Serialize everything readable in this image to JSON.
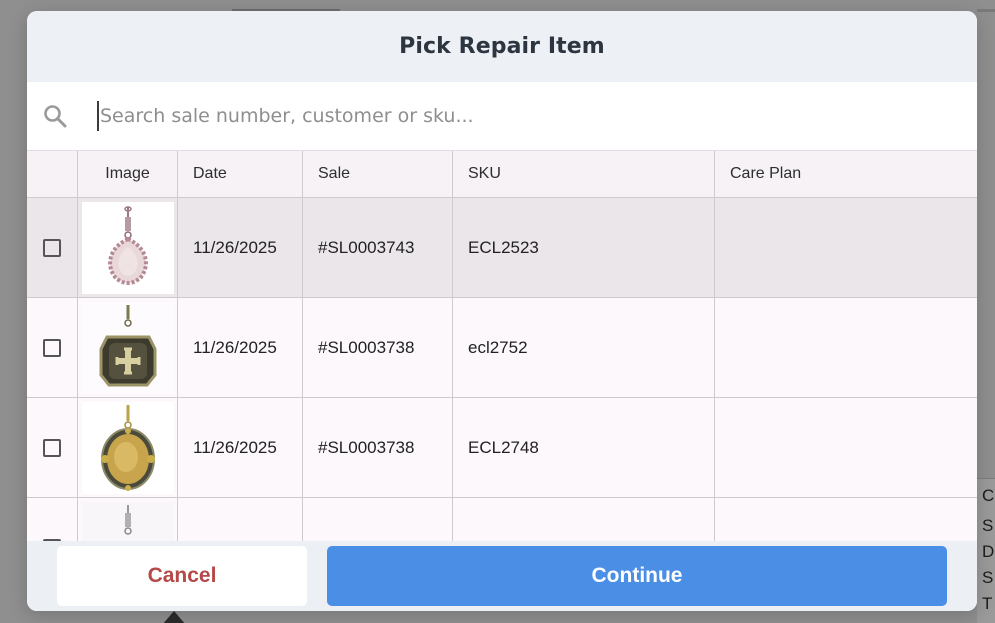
{
  "modal": {
    "title": "Pick Repair Item",
    "search": {
      "placeholder": "Search sale number, customer or sku...",
      "value": ""
    },
    "columns": [
      "",
      "Image",
      "Date",
      "Sale",
      "SKU",
      "Care Plan"
    ],
    "rows": [
      {
        "selected_row": true,
        "checked": false,
        "image": "pendant-pink-stone",
        "date": "11/26/2025",
        "sale": "#SL0003743",
        "sku": "ECL2523",
        "care_plan": ""
      },
      {
        "selected_row": false,
        "checked": false,
        "image": "pendant-cross-medallion",
        "date": "11/26/2025",
        "sale": "#SL0003738",
        "sku": "ecl2752",
        "care_plan": ""
      },
      {
        "selected_row": false,
        "checked": false,
        "image": "pendant-gold-medallion",
        "date": "11/26/2025",
        "sale": "#SL0003738",
        "sku": "ECL2748",
        "care_plan": ""
      },
      {
        "selected_row": false,
        "checked": false,
        "image": "pendant-partial",
        "date": "",
        "sale": "",
        "sku": "",
        "care_plan": ""
      }
    ],
    "footer": {
      "cancel_label": "Cancel",
      "continue_label": "Continue"
    }
  },
  "background": {
    "side_panel_letters": [
      "C",
      "S",
      "D",
      "S",
      "T"
    ]
  },
  "colors": {
    "accent": "#4a8ee6",
    "cancel_text": "#b54848",
    "header_bg": "#edf0f4"
  },
  "icons": {
    "search": "search-icon"
  }
}
